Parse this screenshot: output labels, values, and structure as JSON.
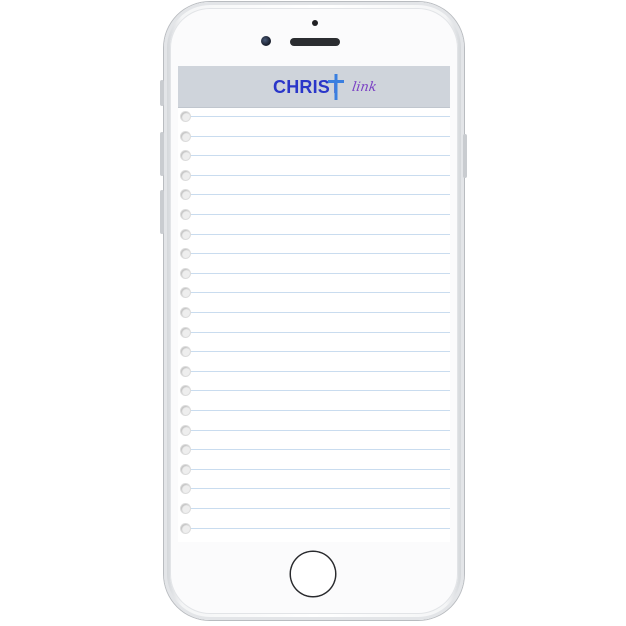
{
  "app": {
    "logo_main": "CHRIST",
    "logo_script": "link"
  },
  "colors": {
    "header_bg": "#cfd4db",
    "logo_blue": "#2a36c9",
    "logo_purple": "#7a3fc4",
    "rule_line": "#c9dcef"
  },
  "notepad": {
    "line_count": 22
  }
}
